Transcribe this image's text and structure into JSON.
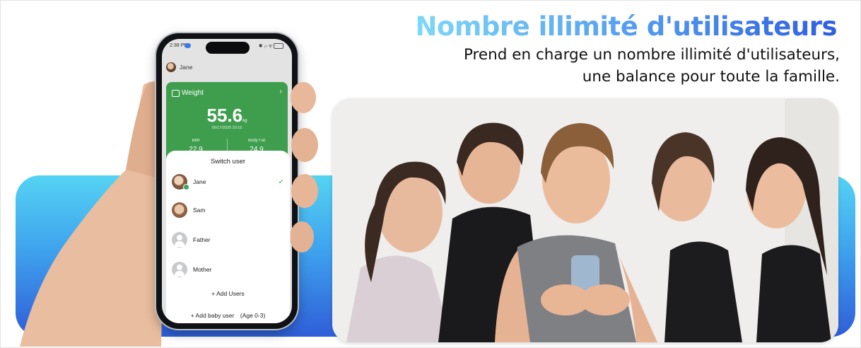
{
  "headline": {
    "title": "Nombre illimité d'utilisateurs",
    "subtitle_line1": "Prend en charge un nombre illimité d'utilisateurs,",
    "subtitle_line2": "une balance pour toute la famille."
  },
  "phone": {
    "status": {
      "time": "2:38 PM",
      "icons": "✱ ᵢₗ ᯤ"
    },
    "header_user": "Jane",
    "weight_card": {
      "label": "Weight",
      "value": "55.6",
      "unit": "kg",
      "date": "06/17/2025 20:15",
      "bmi_label": "BMI",
      "bmi_value": "22.9",
      "bodyfat_label": "Body Fat",
      "bodyfat_value": "24.9"
    },
    "switch_sheet": {
      "title": "Switch user",
      "users": [
        {
          "name": "Jane",
          "selected": true,
          "avatar": "photo-avatar-icon"
        },
        {
          "name": "Sam",
          "selected": false,
          "avatar": "photo-avatar-icon"
        },
        {
          "name": "Father",
          "selected": false,
          "avatar": "default-avatar-icon"
        },
        {
          "name": "Mother",
          "selected": false,
          "avatar": "default-avatar-icon"
        }
      ],
      "add_users": "+ Add Users",
      "add_baby": "+ Add baby user　(Age 0-3)"
    }
  },
  "colors": {
    "accent_green": "#3f9e4d",
    "band_top": "#55d3f3",
    "band_bottom": "#2f5ed8",
    "title_gradient_start": "#7fd8f8",
    "title_gradient_end": "#2f5fe0"
  }
}
